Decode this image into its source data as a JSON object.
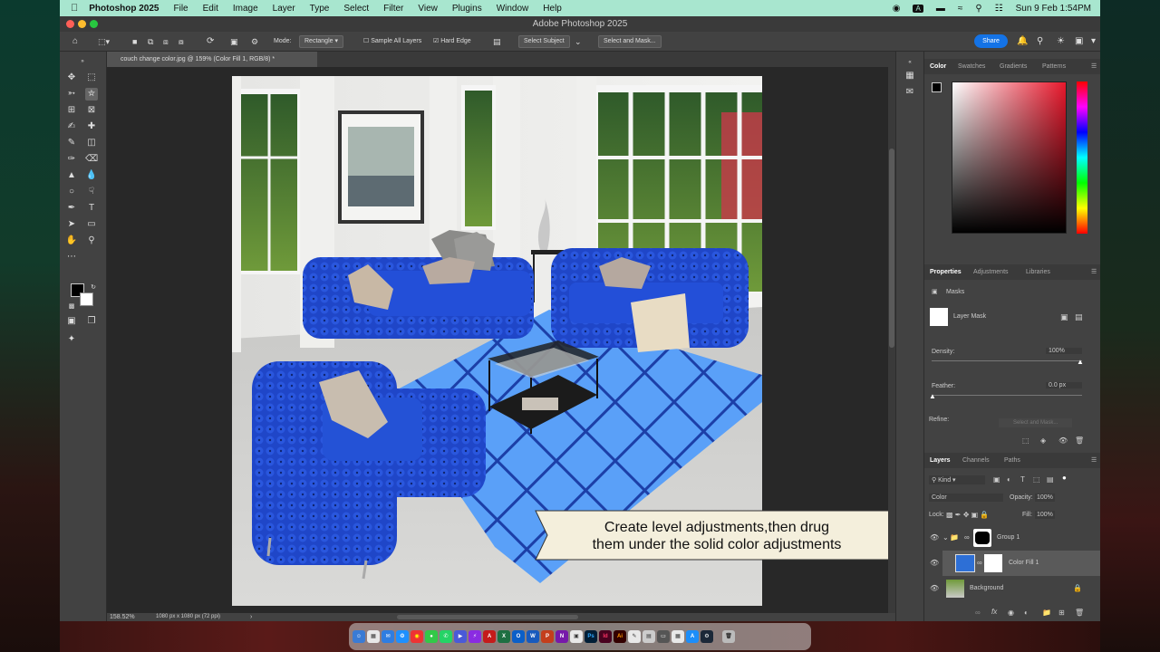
{
  "menubar": {
    "app_name": "Photoshop 2025",
    "items": [
      "File",
      "Edit",
      "Image",
      "Layer",
      "Type",
      "Select",
      "Filter",
      "View",
      "Plugins",
      "Window",
      "Help"
    ],
    "clock": "Sun 9 Feb  1:54PM"
  },
  "window": {
    "title": "Adobe Photoshop 2025"
  },
  "options": {
    "mode_label": "Mode:",
    "mode_value": "Rectangle",
    "sample_all_layers": "Sample All Layers",
    "hard_edge": "Hard Edge",
    "select_subject": "Select Subject",
    "select_and_mask": "Select and Mask...",
    "share": "Share"
  },
  "document": {
    "tab_title": "couch change color.jpg @ 159% (Color Fill 1, RGB/8) *",
    "zoom": "158.52%",
    "size_info": "1080 px x 1080 px (72 ppi)"
  },
  "annotation": {
    "line1": "Create level adjustments,then drug",
    "line2": "them under the solid color adjustments"
  },
  "color_panel": {
    "tabs": [
      "Color",
      "Swatches",
      "Gradients",
      "Patterns"
    ]
  },
  "properties_panel": {
    "tabs": [
      "Properties",
      "Adjustments",
      "Libraries"
    ],
    "masks_label": "Masks",
    "layer_mask_label": "Layer Mask",
    "density_label": "Density:",
    "density_value": "100%",
    "feather_label": "Feather:",
    "feather_value": "0.0 px",
    "refine_label": "Refine:",
    "select_and_mask": "Select and Mask..."
  },
  "layers_panel": {
    "tabs": [
      "Layers",
      "Channels",
      "Paths"
    ],
    "filter_kind": "Kind",
    "blend_mode": "Color",
    "opacity_label": "Opacity:",
    "opacity_value": "100%",
    "lock_label": "Lock:",
    "fill_label": "Fill:",
    "fill_value": "100%",
    "layers": [
      {
        "name": "Group 1"
      },
      {
        "name": "Color Fill 1"
      },
      {
        "name": "Background"
      }
    ]
  },
  "colors": {
    "accent": "#1473e6",
    "menubar": "#a8e6cf",
    "couch_blue": "#1f46c8",
    "rug_blue": "#4a8cf0"
  }
}
